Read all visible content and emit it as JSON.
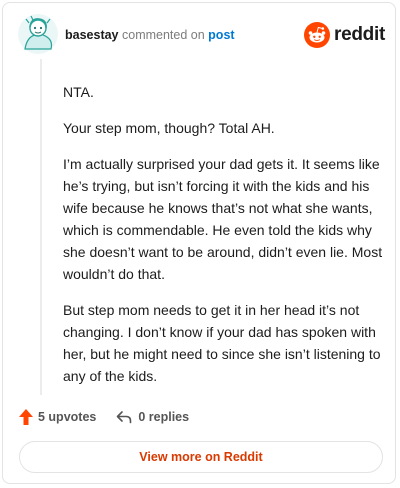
{
  "header": {
    "username": "basestay",
    "action_text": "commented on",
    "target_text": "post",
    "logo_text": "reddit",
    "logo_icon": "reddit-snoo-icon"
  },
  "comment": {
    "paragraphs": [
      "NTA.",
      "Your step mom, though? Total AH.",
      "I’m actually surprised your dad gets it. It seems like he’s trying, but isn’t forcing it with the kids and his wife because he knows that’s not what she wants, which is commendable. He even told the kids why she doesn’t want to be around, didn’t even lie. Most wouldn’t do that.",
      "But step mom needs to get it in her head it’s not changing. I don’t know if your dad has spoken with her, but he might need to since she isn’t listening to any of the kids."
    ]
  },
  "footer": {
    "upvotes_label": "5 upvotes",
    "replies_label": "0 replies",
    "view_more_label": "View more on Reddit"
  },
  "colors": {
    "accent": "#ff4500",
    "link": "#0079d3",
    "cta": "#d93a00"
  }
}
